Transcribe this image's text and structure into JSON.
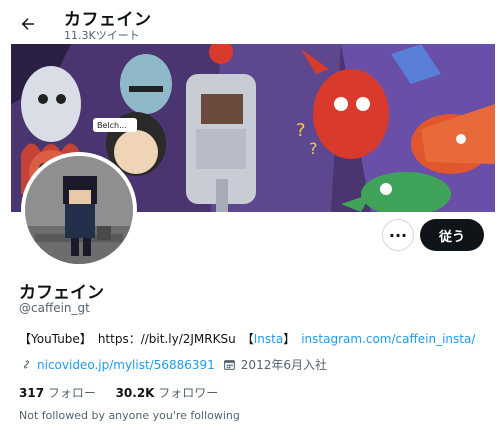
{
  "header": {
    "title": "カフェイン",
    "tweet_count": "11.3Kツイート",
    "back_icon": "arrow-left-icon"
  },
  "banner": {
    "bubble_text": "Belch...",
    "colors": {
      "sky": "#3b2a5a",
      "accent_red": "#d83a2b",
      "accent_green": "#3fa35a"
    }
  },
  "actions": {
    "more_label": "···",
    "follow_label": "従う"
  },
  "profile": {
    "display_name": "カフェイン",
    "handle": "@caffein_gt",
    "bio": {
      "youtube_label": "【YouTube】",
      "youtube_url": "https：//bit.ly/2JMRKSu",
      "insta_open": "【",
      "insta_label": "Insta",
      "insta_close": "】",
      "insta_url": "instagram.com/caffein_insta/"
    },
    "website": "nicovideo.jp/mylist/56886391",
    "joined": "2012年6月入社",
    "following_count": "317",
    "following_label": "フォロー",
    "followers_count": "30.2K",
    "followers_label": "フォロワー",
    "followed_by": "Not followed by anyone you're following"
  },
  "colors": {
    "link": "#1d9bf0",
    "muted": "#536471",
    "text": "#0f1419"
  }
}
